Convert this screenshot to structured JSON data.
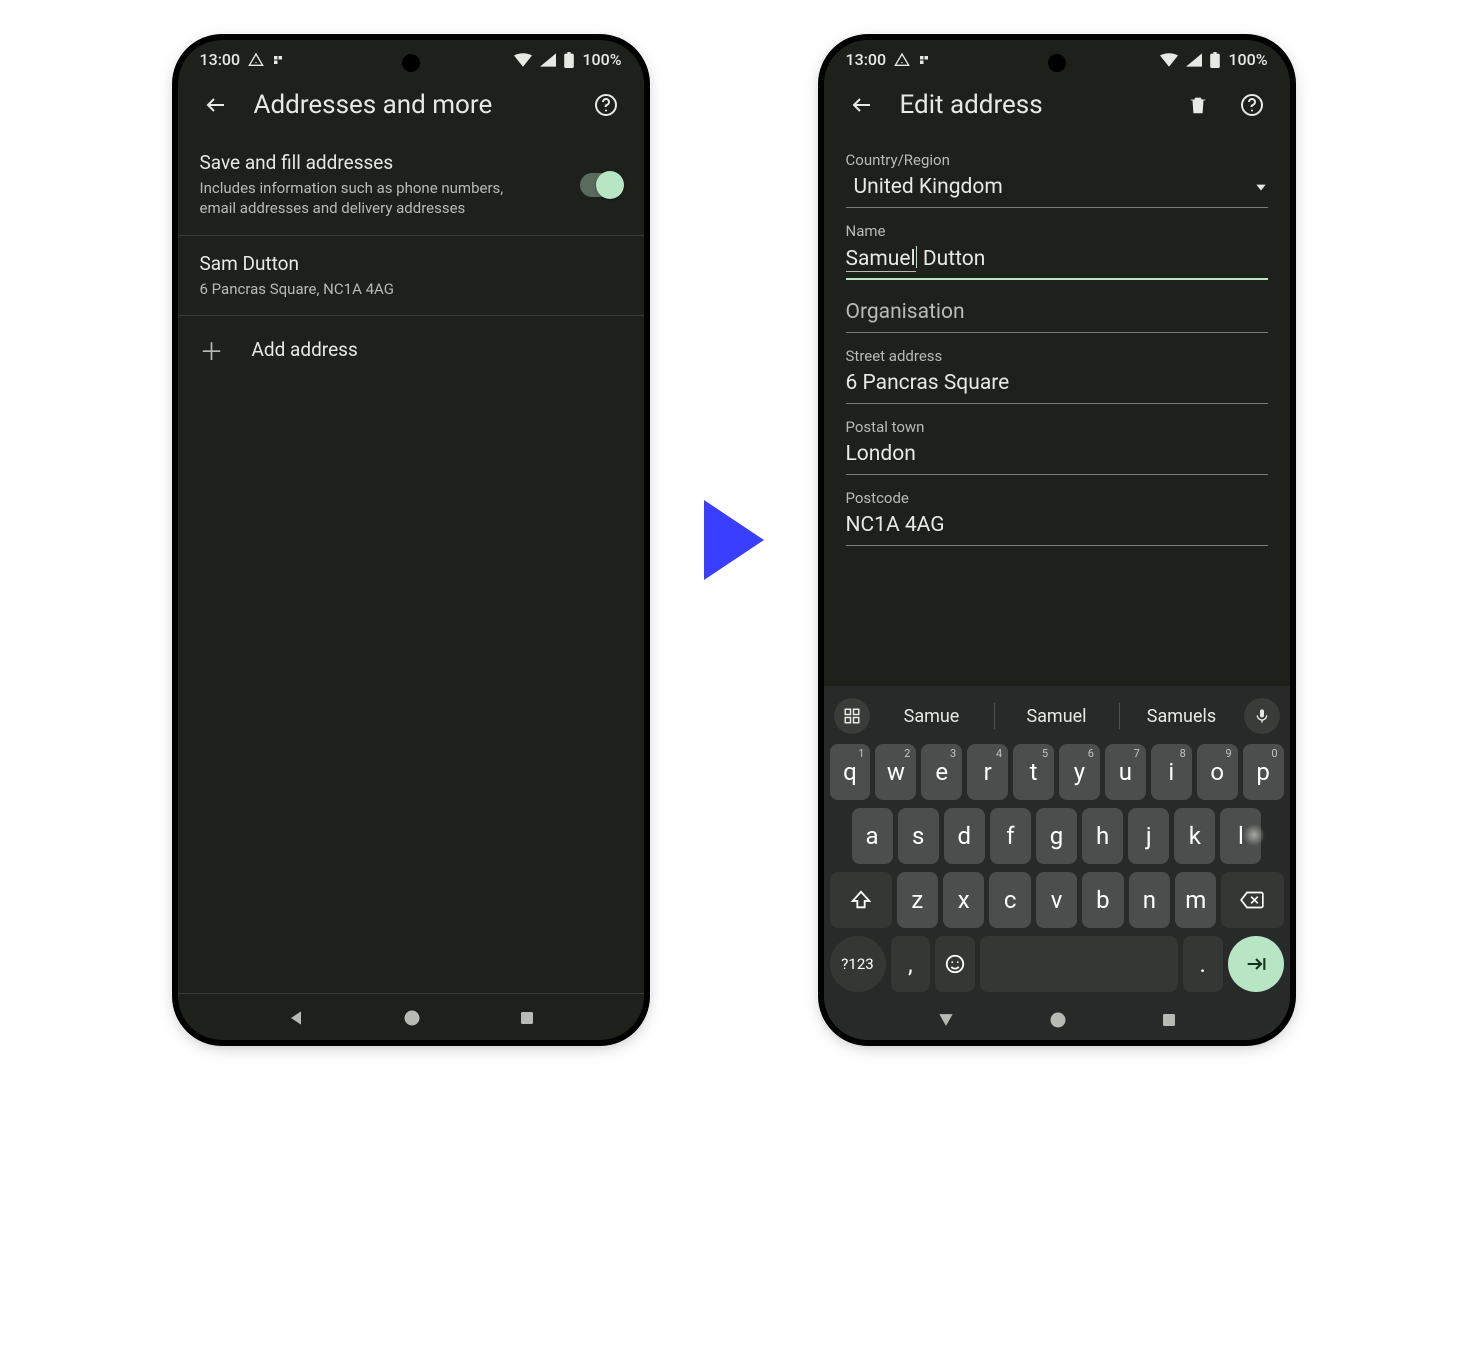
{
  "status": {
    "time": "13:00",
    "battery": "100%"
  },
  "left": {
    "title": "Addresses and more",
    "save": {
      "title": "Save and fill addresses",
      "desc": "Includes information such as phone numbers, email addresses and delivery addresses",
      "on": true
    },
    "entries": [
      {
        "name": "Sam Dutton",
        "line": "6 Pancras Square, NC1A 4AG"
      }
    ],
    "add": "Add address"
  },
  "right": {
    "title": "Edit address",
    "country_label": "Country/Region",
    "country": "United Kingdom",
    "fields": {
      "name_label": "Name",
      "name_first": "Samuel",
      "name_rest": " Dutton",
      "org_label": "Organisation",
      "org": "",
      "street_label": "Street address",
      "street": "6 Pancras Square",
      "town_label": "Postal town",
      "town": "London",
      "post_label": "Postcode",
      "post": "NC1A 4AG"
    }
  },
  "kb": {
    "suggestions": [
      "Samue",
      "Samuel",
      "Samuels"
    ],
    "row1": [
      "q",
      "w",
      "e",
      "r",
      "t",
      "y",
      "u",
      "i",
      "o",
      "p"
    ],
    "nums": [
      "1",
      "2",
      "3",
      "4",
      "5",
      "6",
      "7",
      "8",
      "9",
      "0"
    ],
    "row2": [
      "a",
      "s",
      "d",
      "f",
      "g",
      "h",
      "j",
      "k",
      "l"
    ],
    "row3": [
      "z",
      "x",
      "c",
      "v",
      "b",
      "n",
      "m"
    ],
    "numkey": "?123",
    "comma": ",",
    "period": "."
  }
}
